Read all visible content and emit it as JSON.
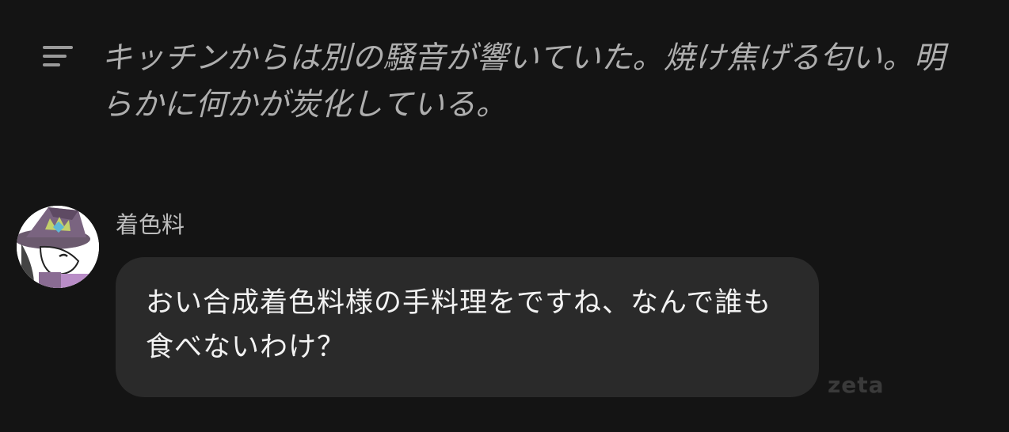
{
  "narration": {
    "icon": "narration-lines-icon",
    "text": "キッチンからは別の騒音が響いていた。焼け焦げる匂い。明らかに何かが炭化している。"
  },
  "message": {
    "avatar": "character-avatar",
    "sender": "着色料",
    "text": "おい合成着色料様の手料理をですね、なんで誰も食べないわけ？"
  },
  "watermark": "zeta",
  "colors": {
    "background": "#141414",
    "bubble": "#2a2a2a",
    "narration_text": "#aeaeae",
    "message_text": "#f2f2f2"
  }
}
